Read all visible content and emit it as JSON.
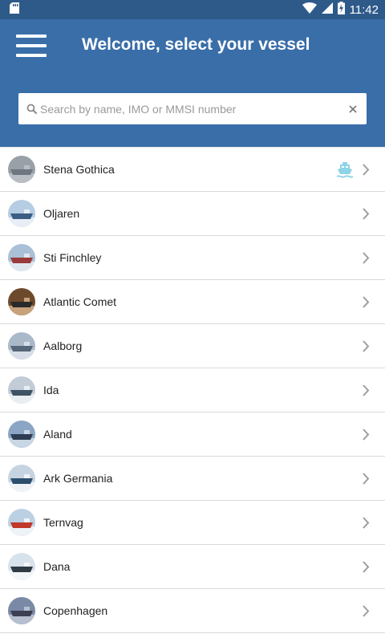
{
  "status_bar": {
    "time": "11:42",
    "icons": [
      "sd-card-icon",
      "wifi-icon",
      "cell-signal-icon",
      "battery-charging-icon"
    ],
    "background": "#2e5a8a"
  },
  "header": {
    "title": "Welcome, select your vessel",
    "menu_icon": "hamburger-menu-icon",
    "background": "#3a6ea8"
  },
  "search": {
    "placeholder": "Search by name, IMO or MMSI number",
    "value": "",
    "search_icon": "search-icon",
    "clear_icon": "close-icon"
  },
  "vessels": [
    {
      "name": "Stena Gothica",
      "active": true,
      "colors": [
        "#9aa0a8",
        "#6f7680",
        "#b9bec5"
      ]
    },
    {
      "name": "Oljaren",
      "active": false,
      "colors": [
        "#b6cde3",
        "#3d5f86",
        "#e7eef6"
      ]
    },
    {
      "name": "Sti Finchley",
      "active": false,
      "colors": [
        "#a9c0d6",
        "#9a3a3a",
        "#dfe7ef"
      ]
    },
    {
      "name": "Atlantic Comet",
      "active": false,
      "colors": [
        "#6e4a2c",
        "#2a2a2a",
        "#c8a27a"
      ]
    },
    {
      "name": "Aalborg",
      "active": false,
      "colors": [
        "#aab9c9",
        "#56677a",
        "#d7dee7"
      ]
    },
    {
      "name": "Ida",
      "active": false,
      "colors": [
        "#c2ccd6",
        "#3f5366",
        "#e9eef2"
      ]
    },
    {
      "name": "Aland",
      "active": false,
      "colors": [
        "#8aa6c4",
        "#2e3d52",
        "#c9d6e4"
      ]
    },
    {
      "name": "Ark Germania",
      "active": false,
      "colors": [
        "#c6d4e2",
        "#2d4f6e",
        "#f0f3f6"
      ]
    },
    {
      "name": "Ternvag",
      "active": false,
      "colors": [
        "#bcd0e4",
        "#c0392b",
        "#eef3f8"
      ]
    },
    {
      "name": "Dana",
      "active": false,
      "colors": [
        "#d7e2ec",
        "#2f3b45",
        "#f3f6f8"
      ]
    },
    {
      "name": "Copenhagen",
      "active": false,
      "colors": [
        "#7a8aa6",
        "#3c3f52",
        "#b6bfcf"
      ]
    }
  ],
  "icons": {
    "row_chevron": "chevron-right-icon",
    "active_vessel": "ship-icon"
  },
  "accent_colors": {
    "chevron": "#9e9e9e",
    "ship_icon": "#8fd3e8",
    "divider": "#d9d9d9"
  }
}
